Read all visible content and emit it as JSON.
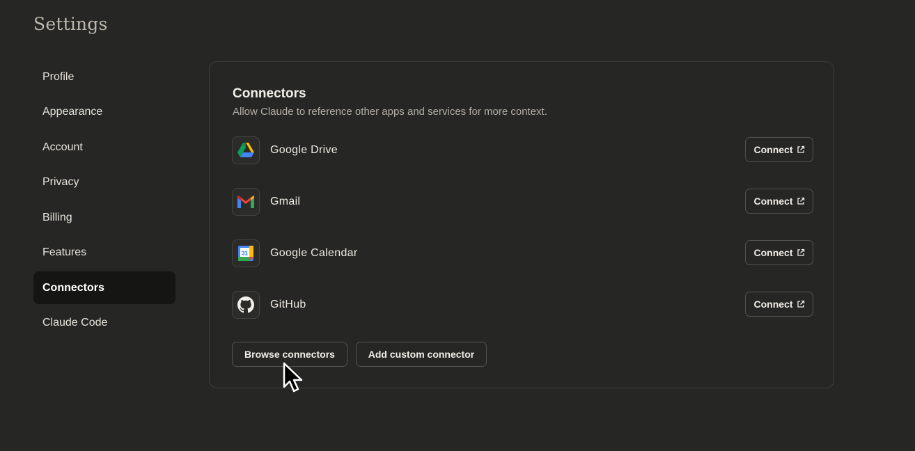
{
  "page": {
    "title": "Settings"
  },
  "sidebar": {
    "items": [
      {
        "label": "Profile"
      },
      {
        "label": "Appearance"
      },
      {
        "label": "Account"
      },
      {
        "label": "Privacy"
      },
      {
        "label": "Billing"
      },
      {
        "label": "Features"
      },
      {
        "label": "Connectors",
        "active": true
      },
      {
        "label": "Claude Code"
      }
    ]
  },
  "connectors": {
    "title": "Connectors",
    "subtitle": "Allow Claude to reference other apps and services for more context.",
    "items": [
      {
        "name": "Google Drive",
        "icon": "google-drive-icon",
        "action": "Connect"
      },
      {
        "name": "Gmail",
        "icon": "gmail-icon",
        "action": "Connect"
      },
      {
        "name": "Google Calendar",
        "icon": "google-calendar-icon",
        "action": "Connect",
        "icon_text": "31"
      },
      {
        "name": "GitHub",
        "icon": "github-icon",
        "action": "Connect"
      }
    ],
    "browse_label": "Browse connectors",
    "custom_label": "Add custom connector"
  },
  "colors": {
    "background": "#262624",
    "active_item": "#151514",
    "border": "#3e3d39"
  }
}
